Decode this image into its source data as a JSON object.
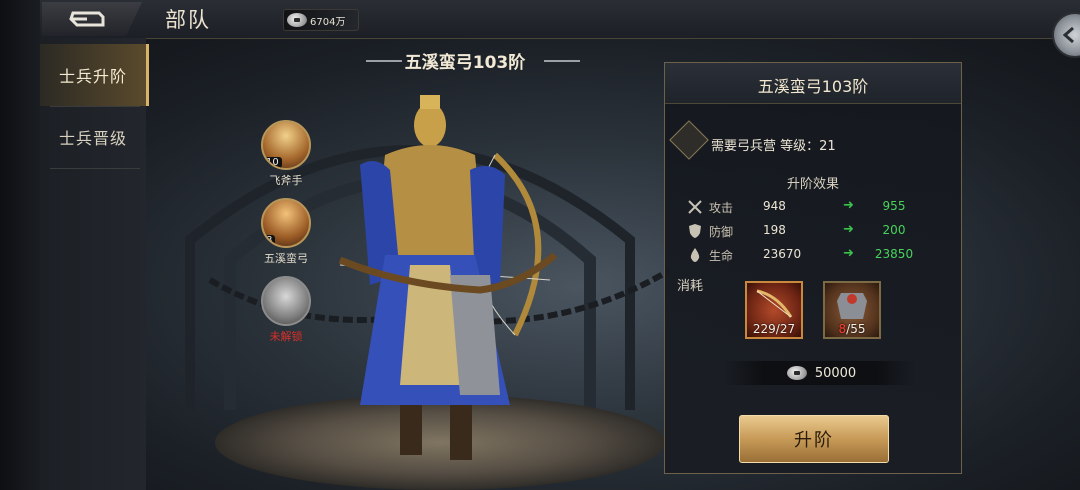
{
  "header": {
    "title": "部队",
    "currency_value": "6704万",
    "back_icon": "back-arrow-icon",
    "close_icon": "close-chevron-icon"
  },
  "sidebar": {
    "items": [
      {
        "label": "士兵升阶",
        "active": true
      },
      {
        "label": "士兵晋级",
        "active": false
      }
    ]
  },
  "unit_title": "五溪蛮弓103阶",
  "units": [
    {
      "name": "飞斧手",
      "level": "10",
      "locked": false
    },
    {
      "name": "五溪蛮弓",
      "level": "8",
      "locked": false
    },
    {
      "name": "未解锁",
      "level": "",
      "locked": true
    }
  ],
  "panel": {
    "title": "五溪蛮弓103阶",
    "requirement": "需要弓兵营 等级：21",
    "effect_title": "升阶效果",
    "stats": [
      {
        "label": "攻击",
        "old": "948",
        "new": "955",
        "icon": "crossed-swords-icon"
      },
      {
        "label": "防御",
        "old": "198",
        "new": "200",
        "icon": "shield-icon"
      },
      {
        "label": "生命",
        "old": "23670",
        "new": "23850",
        "icon": "drop-icon"
      }
    ],
    "cost_label": "消耗",
    "items": [
      {
        "icon": "bow-item-icon",
        "have": "229",
        "need": "27"
      },
      {
        "icon": "armor-item-icon",
        "have": "8",
        "need": "55"
      }
    ],
    "silver_cost": "50000",
    "upgrade_label": "升阶"
  },
  "colors": {
    "accent_gold": "#d9b36a",
    "increase_green": "#47d35b",
    "insufficient_red": "#ff3b30"
  }
}
